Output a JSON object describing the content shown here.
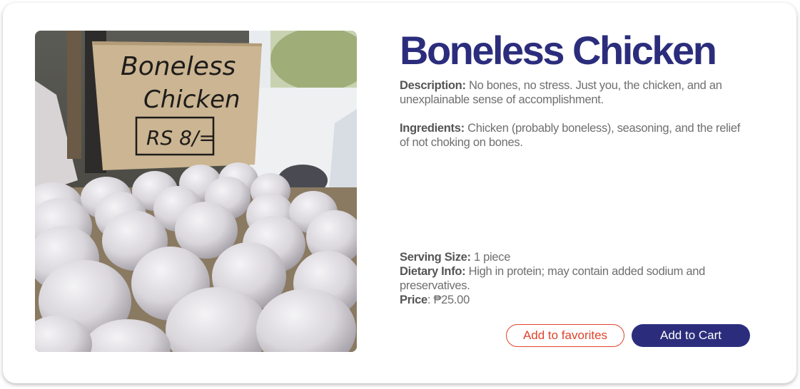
{
  "product": {
    "title": "Boneless Chicken",
    "image_alt": "Eggs on a tray with a sign reading Boneless Chicken RS 8/=",
    "image_sign": {
      "line1": "Boneless",
      "line2": "Chicken",
      "price": "RS 8/="
    },
    "description": {
      "label": "Description:",
      "text": " No bones, no stress. Just you, the chicken, and an unexplainable sense of accomplishment."
    },
    "ingredients": {
      "label": "Ingredients:",
      "text": " Chicken (probably boneless), seasoning, and the relief of not choking on bones."
    },
    "serving_size": {
      "label": "Serving Size:",
      "text": " 1 piece"
    },
    "dietary_info": {
      "label": "Dietary Info:",
      "text": " High in protein; may contain added sodium and preservatives."
    },
    "price": {
      "label": "Price",
      "text": ": ₱25.00"
    }
  },
  "actions": {
    "favorites_label": "Add to favorites",
    "cart_label": "Add to Cart"
  },
  "colors": {
    "brand": "#2b2d7c",
    "accent": "#e0432b",
    "text": "#6f6f6f"
  }
}
